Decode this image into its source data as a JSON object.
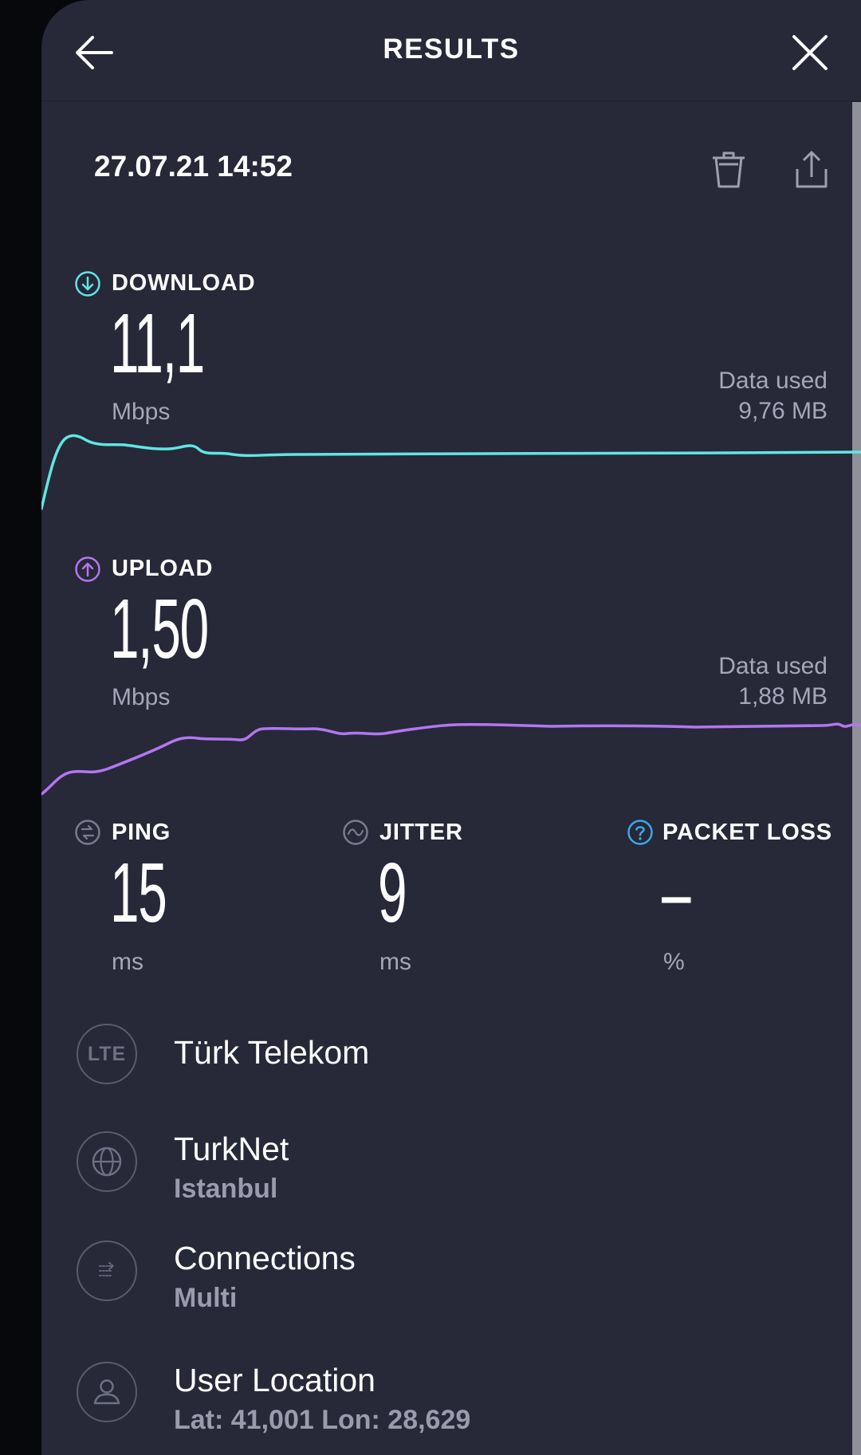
{
  "header": {
    "title": "RESULTS"
  },
  "result": {
    "timestamp": "27.07.21 14:52"
  },
  "download": {
    "label": "DOWNLOAD",
    "value": "11,1",
    "unit": "Mbps",
    "data_used_label": "Data used",
    "data_used_value": "9,76 MB",
    "color": "#5fe6e4"
  },
  "upload": {
    "label": "UPLOAD",
    "value": "1,50",
    "unit": "Mbps",
    "data_used_label": "Data used",
    "data_used_value": "1,88 MB",
    "color": "#b476f0"
  },
  "ping": {
    "label": "PING",
    "value": "15",
    "unit": "ms"
  },
  "jitter": {
    "label": "JITTER",
    "value": "9",
    "unit": "ms"
  },
  "packet_loss": {
    "label": "PACKET LOSS",
    "value": "–",
    "unit": "%",
    "color": "#3aa9e6"
  },
  "details": {
    "carrier": {
      "badge": "LTE",
      "title": "Türk Telekom"
    },
    "server": {
      "title": "TurkNet",
      "subtitle": "Istanbul"
    },
    "connections": {
      "title": "Connections",
      "subtitle": "Multi"
    },
    "location": {
      "title": "User Location",
      "subtitle": "Lat: 41,001 Lon: 28,629"
    }
  }
}
